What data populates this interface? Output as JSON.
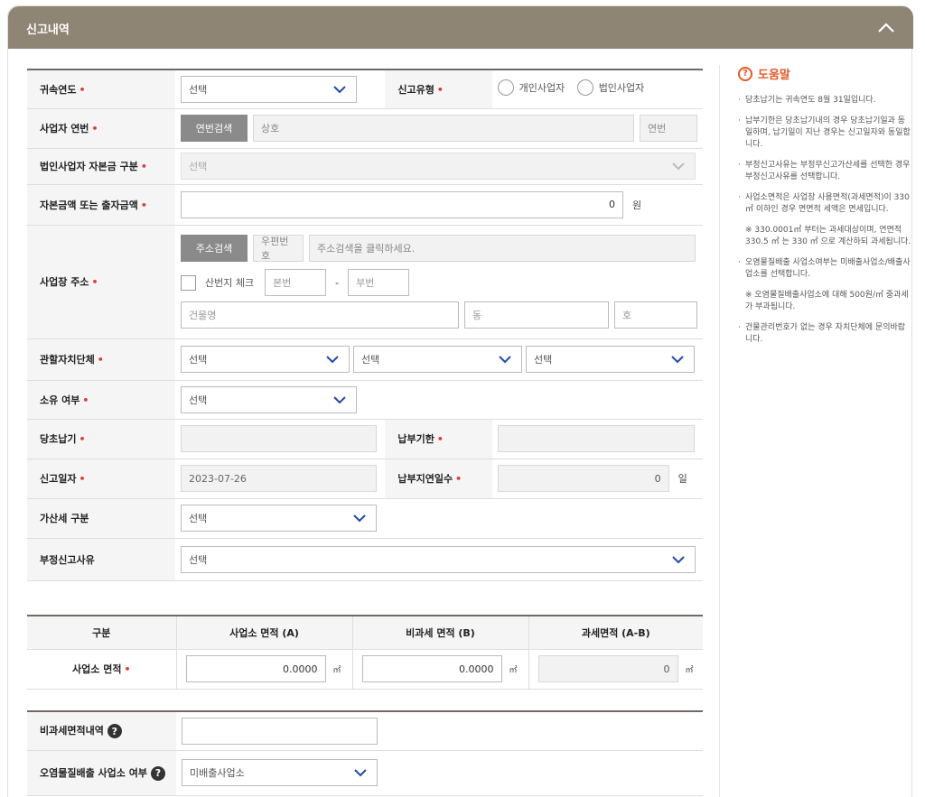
{
  "header": {
    "title": "신고내역"
  },
  "form": {
    "attribution_year": {
      "label": "귀속연도",
      "value": "선택"
    },
    "report_type": {
      "label": "신고유형",
      "options": [
        "개인사업자",
        "법인사업자"
      ]
    },
    "business_serial": {
      "label": "사업자 연번",
      "search_button": "연번검색",
      "company_placeholder": "상호",
      "serial_placeholder": "연번"
    },
    "capital_category": {
      "label": "법인사업자 자본금 구분",
      "value": "선택"
    },
    "capital_amount": {
      "label": "자본금액 또는 출자금액",
      "value": "0",
      "unit": "원"
    },
    "business_address": {
      "label": "사업장 주소",
      "search_button": "주소검색",
      "zip_placeholder": "우편번호",
      "address_placeholder": "주소검색을 클릭하세요.",
      "mountain_check_label": "산번지 체크",
      "main_no_placeholder": "본번",
      "dash": "-",
      "sub_no_placeholder": "부번",
      "building_placeholder": "건물명",
      "dong_placeholder": "동",
      "ho_placeholder": "호"
    },
    "local_government": {
      "label": "관할자치단체",
      "selects": [
        "선택",
        "선택",
        "선택"
      ]
    },
    "ownership": {
      "label": "소유 여부",
      "value": "선택"
    },
    "initial_due": {
      "label": "당초납기",
      "value": ""
    },
    "payment_deadline": {
      "label": "납부기한",
      "value": ""
    },
    "report_date": {
      "label": "신고일자",
      "value": "2023-07-26"
    },
    "late_days": {
      "label": "납부지연일수",
      "value": "0",
      "unit": "일"
    },
    "penalty_type": {
      "label": "가산세 구분",
      "value": "선택"
    },
    "improper_reason": {
      "label": "부정신고사유",
      "value": "선택"
    }
  },
  "area_table": {
    "headers": [
      "구분",
      "사업소 면적 (A)",
      "비과세 면적 (B)",
      "과세면적 (A-B)"
    ],
    "row_label": "사업소 면적",
    "values": [
      "0.0000",
      "0.0000",
      "0"
    ],
    "unit": "㎡"
  },
  "bottom": {
    "nontax_detail": {
      "label": "비과세면적내역",
      "value": ""
    },
    "pollutant": {
      "label": "오염물질배출 사업소 여부",
      "value": "미배출사업소"
    }
  },
  "help": {
    "title": "도움말",
    "items": [
      {
        "type": "bullet",
        "text": "당초납기는 귀속연도 8월 31일입니다."
      },
      {
        "type": "bullet",
        "text": "납부기한은 당초납기내의 경우 당초납기일과 동일하며, 납기일이 지난 경우는 신고일자와 동일합니다."
      },
      {
        "type": "bullet",
        "text": "부정신고사유는 부정무신고가산세를 선택한 경우 부정신고사유를 선택합니다."
      },
      {
        "type": "bullet",
        "text": "사업소면적은 사업장 사용면적(과세면적)이 330㎡ 이하인 경우 면면적 세액은 면세입니다."
      },
      {
        "type": "note",
        "text": "※ 330.0001㎡ 부터는 과세대상이며, 연면적 330.5 ㎡ 는 330 ㎡ 으로 계산하되 과세됩니다."
      },
      {
        "type": "bullet",
        "text": "오염물질배출 사업소여부는 미배출사업소/배출사업소를 선택합니다."
      },
      {
        "type": "note",
        "text": "※ 오염물질배출사업소에 대해 500원/㎡ 중과세가 부과됩니다."
      },
      {
        "type": "bullet",
        "text": "건물관리번호가 없는 경우 자치단체에 문의바랍니다."
      }
    ]
  },
  "colors": {
    "header_bg": "#8f8575",
    "required": "#e4392f",
    "help_accent": "#e25a28",
    "select_chevron": "#1f4aa8"
  }
}
